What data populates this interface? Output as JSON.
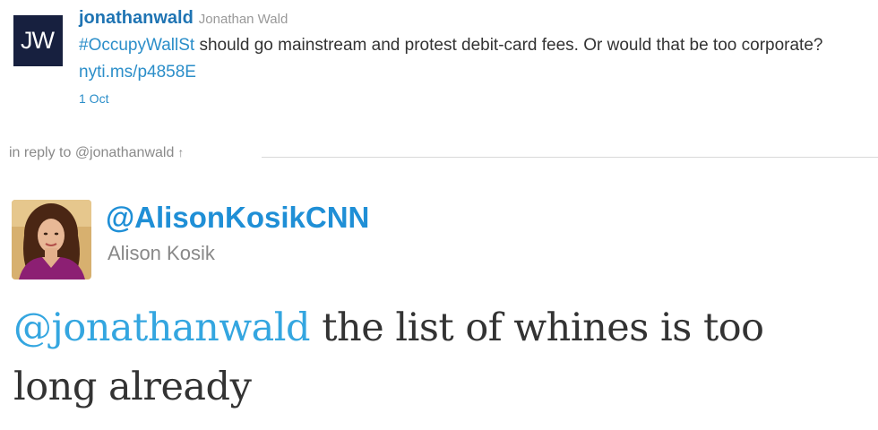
{
  "parent_tweet": {
    "avatar_initials": "JW",
    "screen_name": "jonathanwald",
    "full_name": "Jonathan Wald",
    "hashtag": "#OccupyWallSt",
    "text": " should go mainstream and protest debit-card fees. Or would that be too corporate? ",
    "link": "nyti.ms/p4858E",
    "date": "1 Oct"
  },
  "reply_context": {
    "label": "in reply to @jonathanwald",
    "arrow": "↑"
  },
  "tweet": {
    "screen_name": "@AlisonKosikCNN",
    "full_name": "Alison Kosik",
    "mention": "@jonathanwald",
    "text": " the list of whines is too long already"
  },
  "colors": {
    "link": "#2b8ec9",
    "mention": "#34a6e0",
    "jw_avatar_bg": "#17203f"
  }
}
